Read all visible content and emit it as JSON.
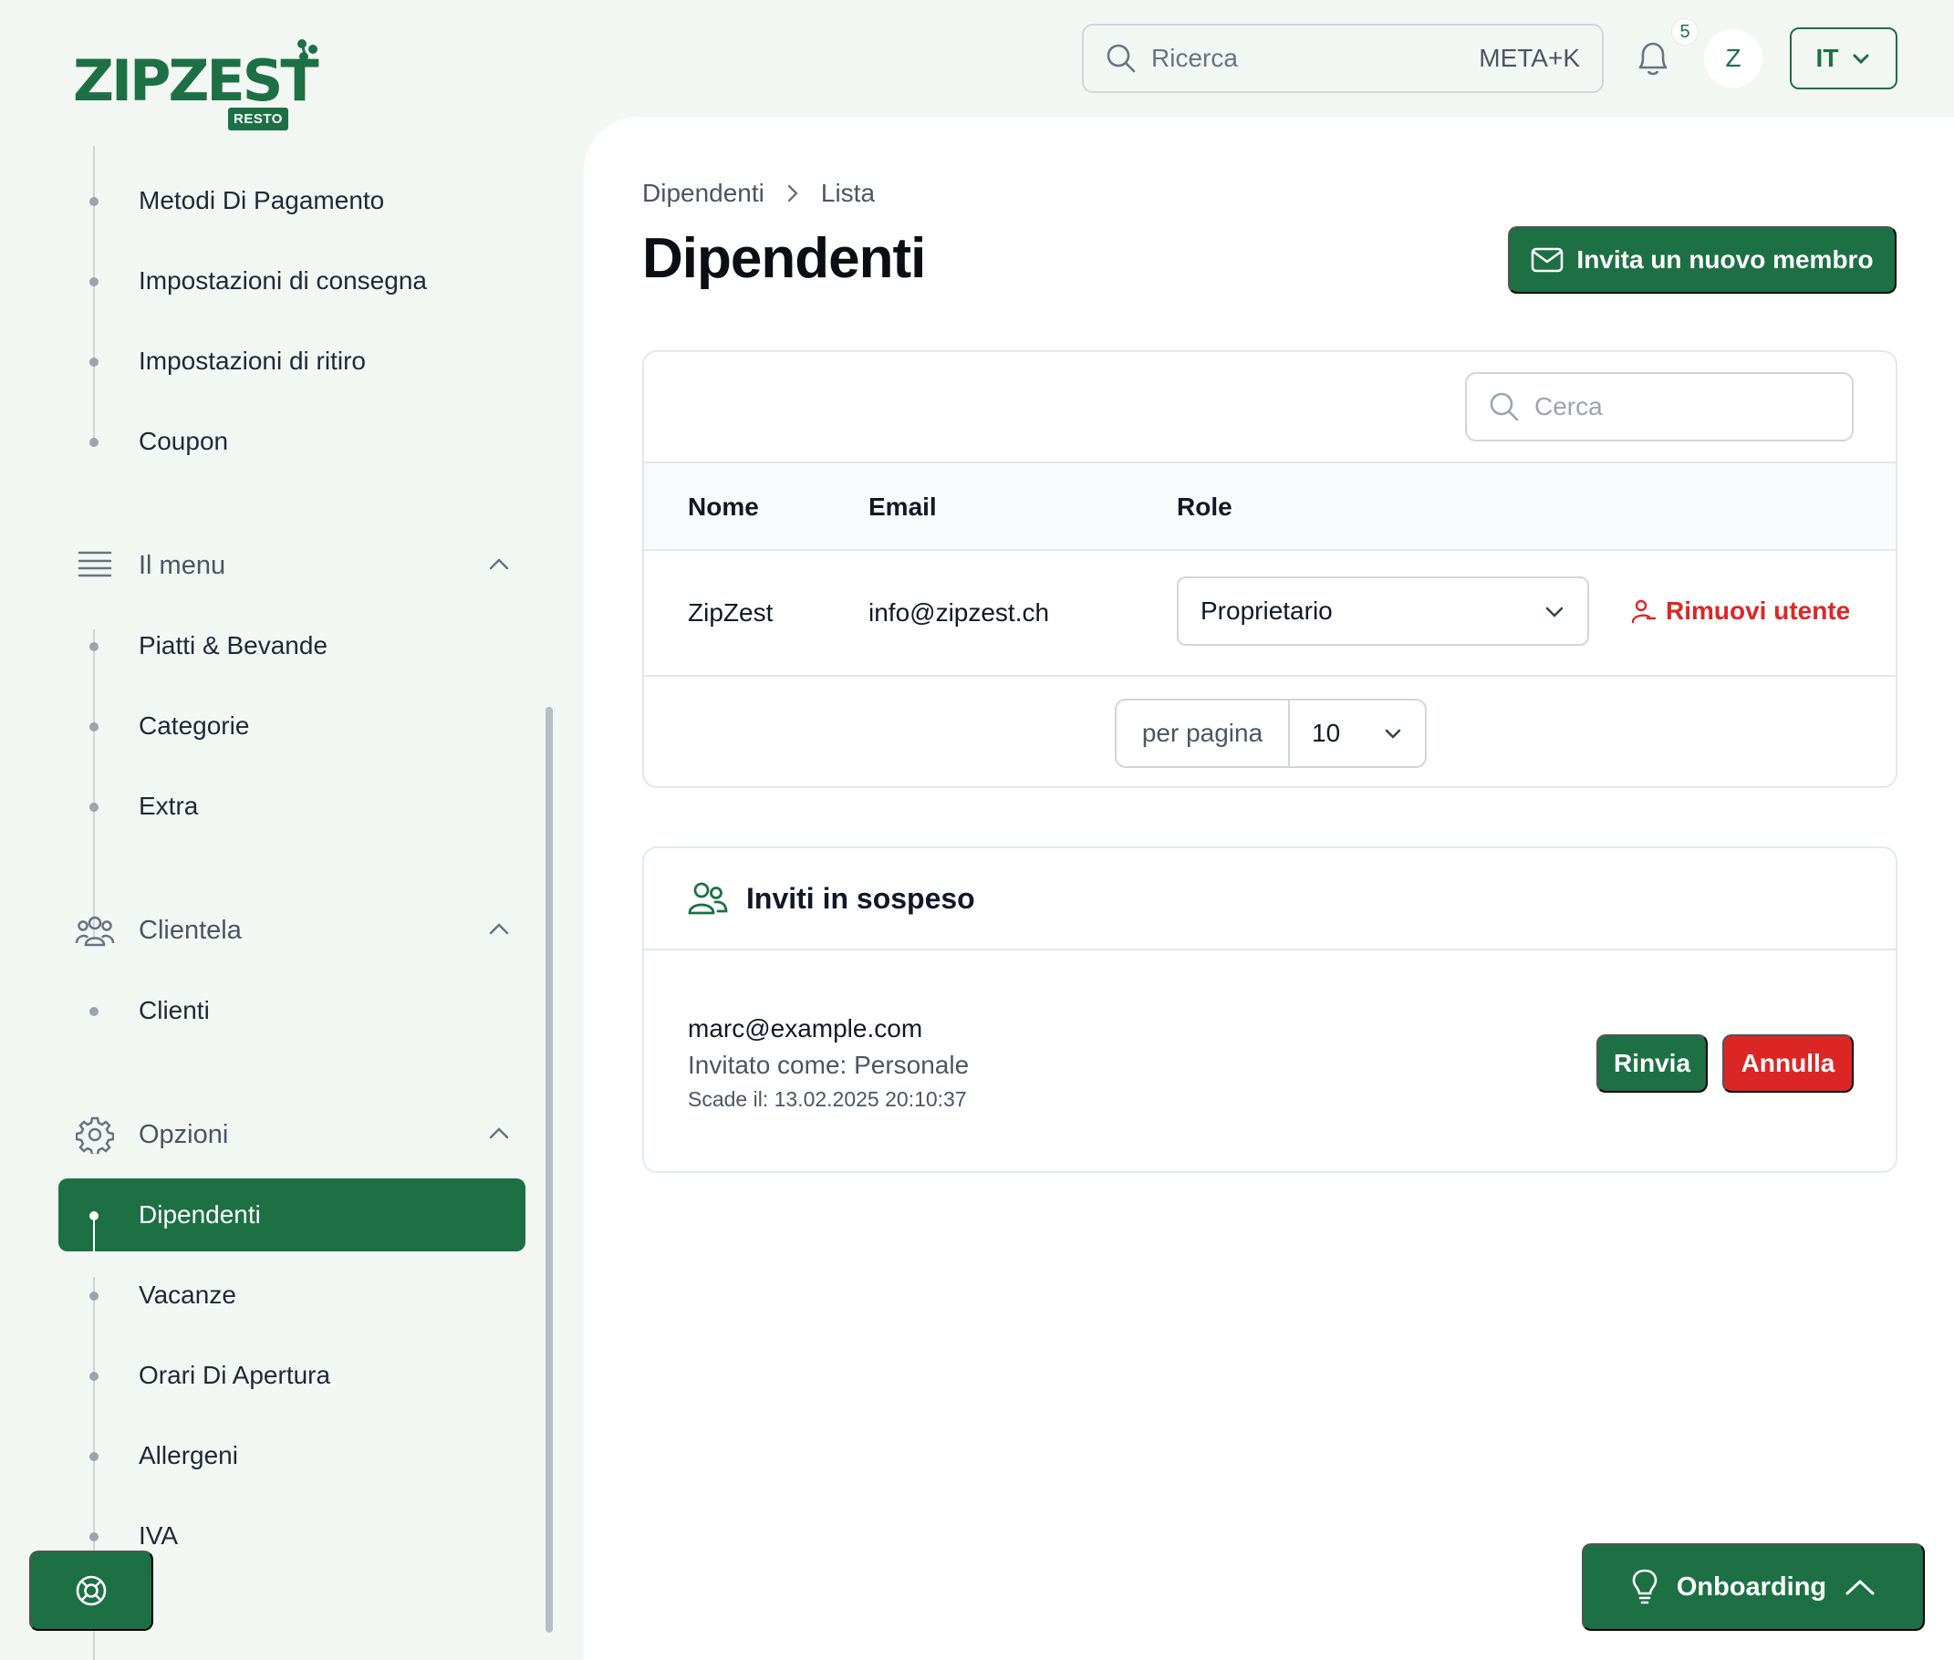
{
  "brand": {
    "name": "ZIPZEST",
    "badge": "RESTO",
    "color": "#1d7044"
  },
  "topbar": {
    "search_placeholder": "Ricerca",
    "search_shortcut": "META+K",
    "notifications_count": "5",
    "avatar_initial": "Z",
    "language": "IT"
  },
  "sidebar": {
    "top_items": [
      {
        "label": "Metodi Di Pagamento"
      },
      {
        "label": "Impostazioni di consegna"
      },
      {
        "label": "Impostazioni di ritiro"
      },
      {
        "label": "Coupon"
      }
    ],
    "groups": [
      {
        "label": "Il menu",
        "icon": "menu-lines-icon",
        "items": [
          "Piatti & Bevande",
          "Categorie",
          "Extra"
        ]
      },
      {
        "label": "Clientela",
        "icon": "users-icon",
        "items": [
          "Clienti"
        ]
      },
      {
        "label": "Opzioni",
        "icon": "gear-icon",
        "items": [
          "Dipendenti",
          "Vacanze",
          "Orari Di Apertura",
          "Allergeni",
          "IVA"
        ],
        "active": "Dipendenti"
      }
    ]
  },
  "page": {
    "breadcrumb": [
      "Dipendenti",
      "Lista"
    ],
    "title": "Dipendenti",
    "invite_button": "Invita un nuovo membro"
  },
  "members": {
    "search_placeholder": "Cerca",
    "columns": [
      "Nome",
      "Email",
      "Role"
    ],
    "rows": [
      {
        "name": "ZipZest",
        "email": "info@zipzest.ch",
        "role": "Proprietario",
        "action": "Rimuovi utente"
      }
    ],
    "per_page_label": "per pagina",
    "per_page_value": "10"
  },
  "invites": {
    "title": "Inviti in sospeso",
    "items": [
      {
        "email": "marc@example.com",
        "role_text": "Invitato come: Personale",
        "expires_text": "Scade il: 13.02.2025 20:10:37",
        "resend": "Rinvia",
        "cancel": "Annulla"
      }
    ]
  },
  "onboarding": {
    "label": "Onboarding"
  },
  "colors": {
    "accent": "#1d7044",
    "danger": "#dc2626",
    "background": "#f3f7f4"
  }
}
